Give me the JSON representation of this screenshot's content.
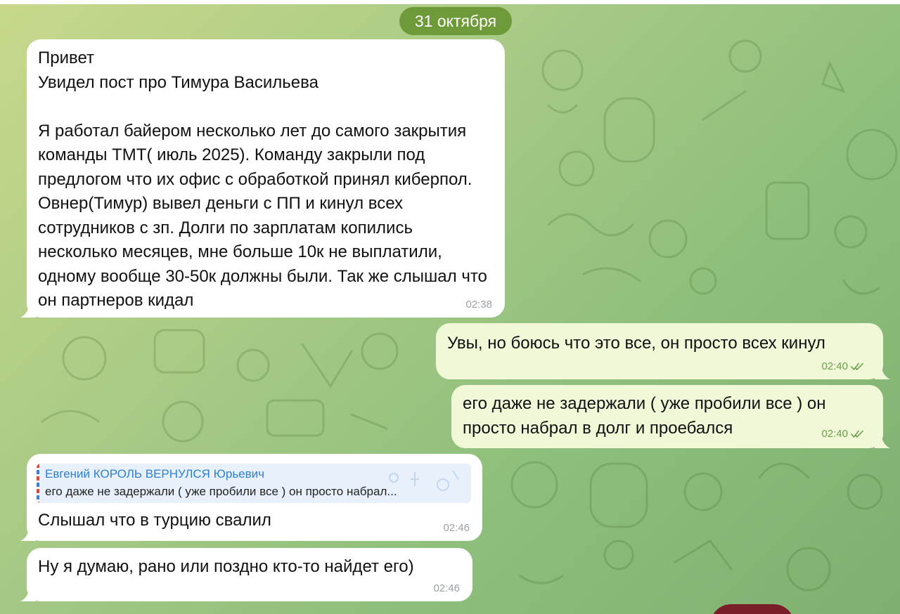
{
  "date_separator": "31 октября",
  "messages": [
    {
      "id": "m1",
      "direction": "incoming",
      "text": "Привет\nУвидел пост про Тимура Васильева\n\nЯ работал байером несколько лет до самого закрытия команды ТМТ( июль 2025). Команду закрыли под предлогом что их офис с обработкой принял киберпол. Овнер(Тимур) вывел деньги с ПП и кинул всех сотрудников с зп. Долги по зарплатам копились несколько месяцев, мне больше 10к не выплатили, одному вообще 30-50к должны были. Так же слышал что он партнеров кидал",
      "time": "02:38"
    },
    {
      "id": "m2",
      "direction": "outgoing",
      "text": "Увы, но боюсь что это все, он просто всех кинул",
      "time": "02:40",
      "status": "read"
    },
    {
      "id": "m3",
      "direction": "outgoing",
      "text": "его даже не задержали ( уже пробили все ) он просто набрал в долг и проебался",
      "time": "02:40",
      "status": "read"
    },
    {
      "id": "m4",
      "direction": "incoming",
      "reply": {
        "name": "Евгений КОРОЛЬ ВЕРНУЛСЯ Юрьевич",
        "text": "его даже не задержали ( уже пробили все ) он просто набрал..."
      },
      "text": "Слышал что в турцию свалил",
      "time": "02:46"
    },
    {
      "id": "m5",
      "direction": "incoming",
      "text": "Ну я думаю, рано или поздно кто-то найдет его)",
      "time": "02:46"
    }
  ],
  "colors": {
    "incoming_bubble": "#ffffff",
    "outgoing_bubble": "#f0f8d8",
    "date_pill": "#6e9a3a",
    "reply_name": "#2f7fd1",
    "outgoing_time": "#6aa049"
  },
  "icons": {
    "read_status": "double-check-icon"
  }
}
